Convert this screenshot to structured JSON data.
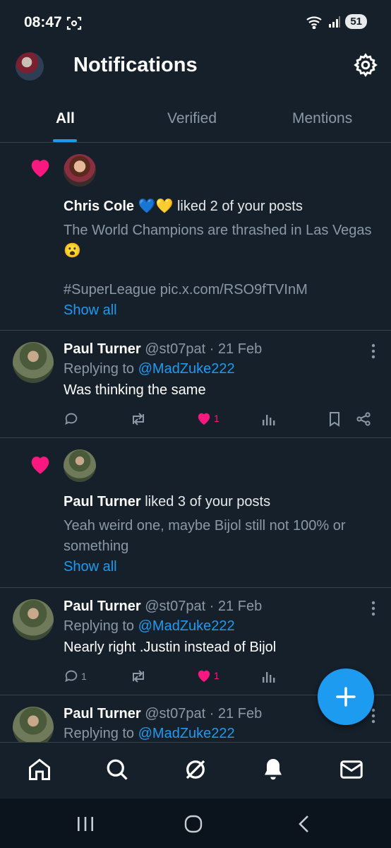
{
  "status_bar": {
    "time": "08:47",
    "battery": "51"
  },
  "header": {
    "title": "Notifications"
  },
  "tabs": [
    {
      "label": "All",
      "active": true
    },
    {
      "label": "Verified",
      "active": false
    },
    {
      "label": "Mentions",
      "active": false
    }
  ],
  "notifications": [
    {
      "type": "like",
      "user": "Chris Cole",
      "emoji": "💙💛",
      "action": "liked 2 of your posts",
      "text": "The World Champions are thrashed in Las Vegas 😮",
      "text2": "#SuperLeague pic.x.com/RSO9fTVInM",
      "show_all": "Show all"
    },
    {
      "type": "reply",
      "user": "Paul Turner",
      "handle": "@st07pat",
      "date": "· 21 Feb",
      "replying_prefix": "Replying to",
      "replying_to": "@MadZuke222",
      "text": "Was thinking the same",
      "reply_count": "",
      "like_count": "1"
    },
    {
      "type": "like",
      "user": "Paul Turner",
      "action": "liked 3 of your posts",
      "text": "Yeah weird one, maybe Bijol still not 100% or something",
      "show_all": "Show all"
    },
    {
      "type": "reply",
      "user": "Paul Turner",
      "handle": "@st07pat",
      "date": "· 21 Feb",
      "replying_prefix": "Replying to",
      "replying_to": "@MadZuke222",
      "text": "Nearly right .Justin instead of Bijol",
      "reply_count": "1",
      "like_count": "1"
    },
    {
      "type": "reply",
      "user": "Paul Turner",
      "handle": "@st07pat",
      "date": "· 21 Feb",
      "replying_prefix": "Replying to",
      "replying_to": "@MadZuke222"
    }
  ],
  "icons": {
    "nav": [
      "home-icon",
      "search-icon",
      "grok-icon",
      "notifications-bell-icon",
      "messages-mail-icon"
    ],
    "system": [
      "recents-icon",
      "home-circle-icon",
      "back-icon"
    ]
  },
  "colors": {
    "background": "#15202b",
    "accent": "#1d9bf0",
    "like": "#f91880",
    "muted": "#8b98a5"
  }
}
